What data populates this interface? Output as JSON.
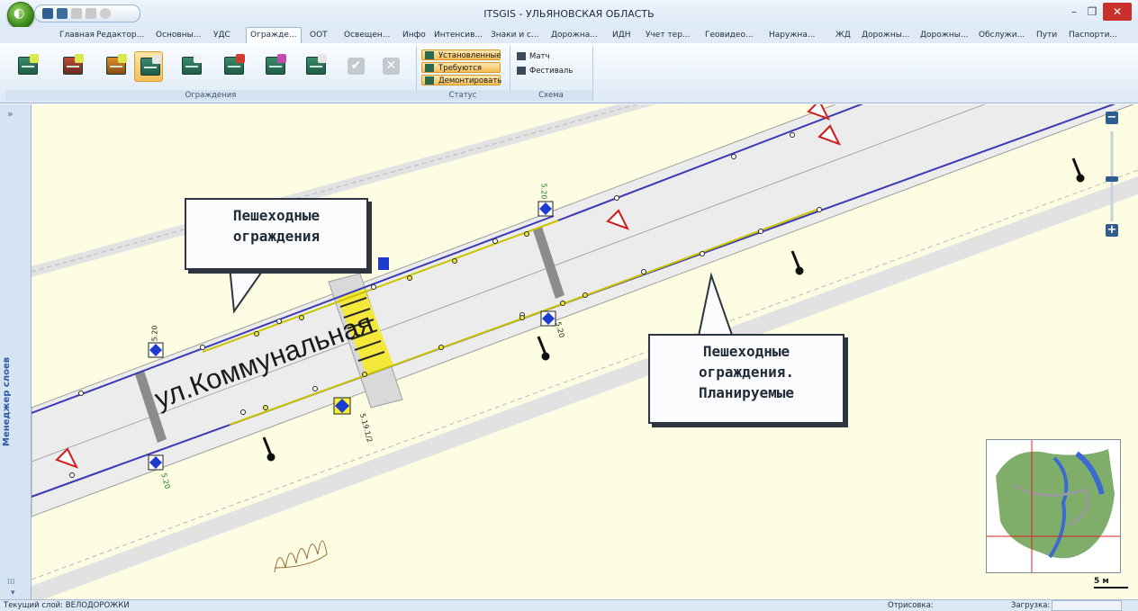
{
  "window": {
    "title": "ITSGIS - УЛЬЯНОВСКАЯ ОБЛАСТЬ",
    "minimize": "–",
    "maximize": "❐",
    "close": "✕"
  },
  "tabs": [
    "Главная",
    "Редактор...",
    "Основны...",
    "УДС",
    "Огражде...",
    "ООТ",
    "Освещен...",
    "Инфо",
    "Интенсив...",
    "Знаки и с...",
    "Дорожна...",
    "ИДН",
    "Учет тер...",
    "Геовидео...",
    "Наружна...",
    "ЖД",
    "Дорожны...",
    "Дорожны...",
    "Обслужи...",
    "Пути",
    "Паспорти..."
  ],
  "active_tab": "Огражде...",
  "ribbon": {
    "fences_group_label": "Ограждения",
    "status_group_label": "Статус",
    "schema_group_label": "Схема",
    "status_buttons": [
      "Установленные",
      "Требуются",
      "Демонтировать"
    ],
    "schema_items": [
      "Матч",
      "Фестиваль"
    ]
  },
  "side_panel": {
    "label": "Менеджер слоев",
    "collapse": "»",
    "grip": "⁞⁞⁞",
    "expand": "▾"
  },
  "map": {
    "street_label": "ул.Коммунальная",
    "callout_top": "Пешеходные\nограждения",
    "callout_bottom": "Пешеходные\nограждения.\nПланируемые",
    "sign_labels": [
      "5.20",
      "5.20",
      "5.19.1/2",
      "5.20",
      "5.20"
    ],
    "zoom_in": "+",
    "zoom_out": "−",
    "scale_label": "5 м"
  },
  "status_bar": {
    "current_layer": "Текущий слой: ВЕЛОДОРОЖКИ",
    "render_label": "Отрисовка:",
    "load_label": "Загрузка:"
  }
}
